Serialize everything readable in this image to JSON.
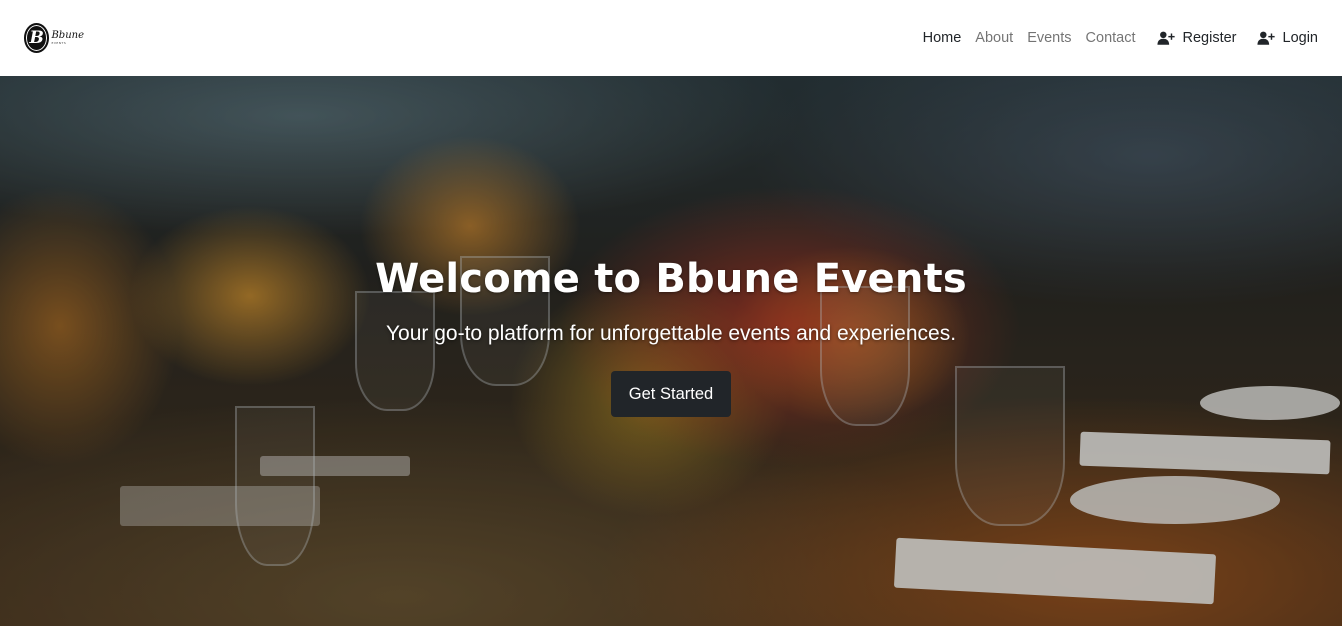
{
  "brand": {
    "logo_letter": "B",
    "logo_text": "Bbune",
    "logo_subtext": "EVENTS"
  },
  "nav": {
    "links": [
      {
        "label": "Home",
        "active": true
      },
      {
        "label": "About",
        "active": false
      },
      {
        "label": "Events",
        "active": false
      },
      {
        "label": "Contact",
        "active": false
      }
    ],
    "register_label": "Register",
    "login_label": "Login",
    "register_icon": "user-plus-icon",
    "login_icon": "user-plus-icon"
  },
  "hero": {
    "title": "Welcome to Bbune Events",
    "subtitle": "Your go-to platform for unforgettable events and experiences.",
    "cta_label": "Get Started",
    "background": "blurred banquet table with flowers and glasses"
  },
  "colors": {
    "navbar_bg": "#ffffff",
    "nav_text_active": "#212529",
    "nav_text_muted": "#8a8a8a",
    "cta_bg": "#212529",
    "cta_text": "#ffffff"
  }
}
